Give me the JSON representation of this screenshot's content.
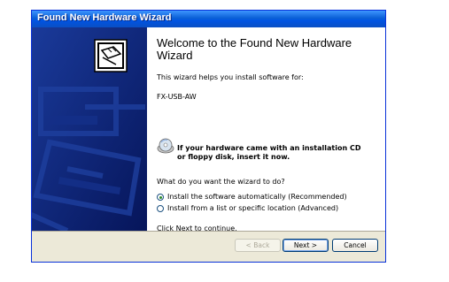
{
  "window": {
    "title": "Found New Hardware Wizard"
  },
  "content": {
    "heading": "Welcome to the Found New Hardware Wizard",
    "intro": "This wizard helps you install software for:",
    "device": "FX-USB-AW",
    "cd_line1": "If your hardware came with an installation CD",
    "cd_line2": "or floppy disk, insert it now.",
    "question": "What do you want the wizard to do?",
    "options": [
      {
        "label": "Install the software automatically (Recommended)",
        "selected": true
      },
      {
        "label": "Install from a list or specific location (Advanced)",
        "selected": false
      }
    ],
    "continue_text": "Click Next to continue."
  },
  "buttons": {
    "back": "< Back",
    "next": "Next >",
    "cancel": "Cancel"
  },
  "icons": {
    "side_graphic": "hardware-card-icon",
    "cd": "cd-icon"
  },
  "colors": {
    "titlebar": "#0054e3",
    "sidepanel": "#0b1f72",
    "footer": "#ece9d8"
  }
}
